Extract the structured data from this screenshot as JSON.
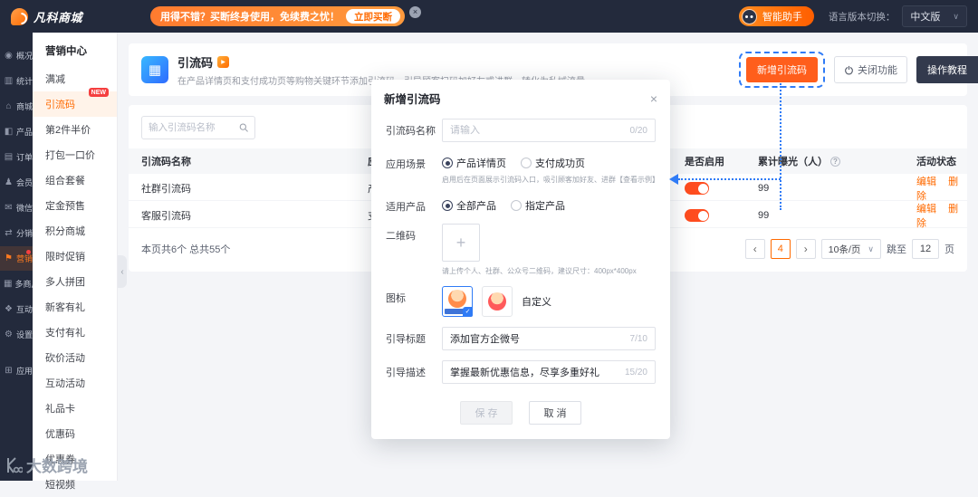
{
  "icons": {
    "chevron_down": "∨",
    "close": "×",
    "collapse_left": "‹",
    "plus": "+",
    "info": "?",
    "play": "▶",
    "qr_glyph": "▦",
    "check": "✓"
  },
  "topbar": {
    "logo_text": "凡科商城",
    "promo_text": "用得不错？买断终身使用，免续费之忧！",
    "promo_button": "立即买断",
    "assistant": "智能助手",
    "lang_label": "语言版本切换：",
    "lang_value": "中文版"
  },
  "nav_rail": {
    "items": [
      {
        "label": "概况",
        "glyph": "◉"
      },
      {
        "label": "统计",
        "glyph": "▥"
      },
      {
        "label": "商城",
        "glyph": "⌂"
      },
      {
        "label": "产品",
        "glyph": "◧"
      },
      {
        "label": "订单",
        "glyph": "▤"
      },
      {
        "label": "会员",
        "glyph": "♟"
      },
      {
        "label": "微信",
        "glyph": "✉"
      },
      {
        "label": "分销",
        "glyph": "⇄"
      },
      {
        "label": "营销",
        "glyph": "⚑"
      },
      {
        "label": "多商户",
        "glyph": "▦"
      },
      {
        "label": "互动",
        "glyph": "❖"
      },
      {
        "label": "设置",
        "glyph": "⚙"
      },
      {
        "label": "应用",
        "glyph": "⊞"
      }
    ]
  },
  "submenu": {
    "header": "营销中心",
    "new_badge": "NEW",
    "items": [
      "满减",
      "引流码",
      "第2件半价",
      "打包一口价",
      "组合套餐",
      "定金预售",
      "积分商城",
      "限时促销",
      "多人拼团",
      "新客有礼",
      "支付有礼",
      "砍价活动",
      "互动活动",
      "礼品卡",
      "优惠码",
      "优惠券",
      "短视频"
    ]
  },
  "page": {
    "title": "引流码",
    "description": "在产品详情页和支付成功页等购物关键环节添加引流码，引导顾客扫码加好友或进群，转化为私域流量",
    "add_button": "新增引流码",
    "close_feature_button": "关闭功能",
    "tutorial_button": "操作教程",
    "search_placeholder": "输入引流码名称"
  },
  "table": {
    "headers": [
      "引流码名称",
      "应用场景",
      "是否启用",
      "累计曝光（人）",
      "活动状态"
    ],
    "rows": [
      {
        "name": "社群引流码",
        "scene": "产品详情页",
        "exposure": "99",
        "actions": [
          "编辑",
          "删除"
        ]
      },
      {
        "name": "客服引流码",
        "scene": "支付成功页",
        "exposure": "99",
        "actions": [
          "编辑",
          "删除"
        ]
      }
    ],
    "summary": "本页共6个 总共55个"
  },
  "pagination": {
    "prev": "‹",
    "current": "4",
    "next": "›",
    "size": "10条/页",
    "jump_prefix": "跳至",
    "jump_value": "12",
    "jump_suffix": "页"
  },
  "modal": {
    "title": "新增引流码",
    "fields": {
      "name_label": "引流码名称",
      "name_placeholder": "请输入",
      "name_counter": "0/20",
      "scene_label": "应用场景",
      "scene_option_1": "产品详情页",
      "scene_option_2": "支付成功页",
      "scene_hint": "启用后在页面展示引流码入口，吸引顾客加好友、进群【查看示例】",
      "product_label": "适用产品",
      "product_option_1": "全部产品",
      "product_option_2": "指定产品",
      "qr_label": "二维码",
      "qr_hint": "请上传个人、社群、公众号二维码，建议尺寸：400px*400px",
      "icon_label": "图标",
      "icon_custom": "自定义",
      "guide_title_label": "引导标题",
      "guide_title_value": "添加官方企微号",
      "guide_title_counter": "7/10",
      "guide_desc_label": "引导描述",
      "guide_desc_value": "掌握最新优惠信息，尽享多重好礼",
      "guide_desc_counter": "15/20"
    },
    "save_button": "保 存",
    "cancel_button": "取 消"
  },
  "watermark": "大数跨境"
}
